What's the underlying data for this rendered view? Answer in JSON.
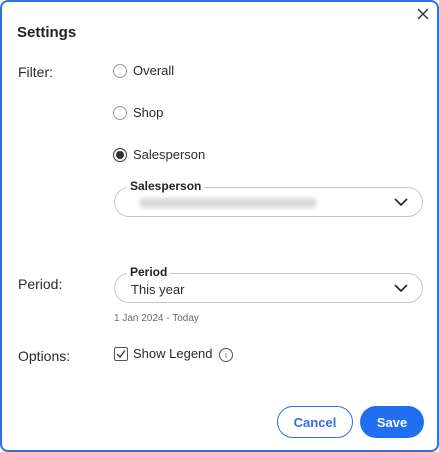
{
  "dialog": {
    "title": "Settings",
    "close_icon": "close-icon"
  },
  "filter": {
    "label": "Filter:",
    "options": [
      {
        "label": "Overall",
        "checked": false
      },
      {
        "label": "Shop",
        "checked": false
      },
      {
        "label": "Salesperson",
        "checked": true
      }
    ],
    "salesperson_select": {
      "legend": "Salesperson",
      "value": ""
    }
  },
  "period": {
    "label": "Period:",
    "select": {
      "legend": "Period",
      "value": "This year"
    },
    "range_hint": "1 Jan 2024 - Today"
  },
  "options": {
    "label": "Options:",
    "show_legend": {
      "label": "Show Legend",
      "checked": true
    },
    "info_icon": "info-icon"
  },
  "actions": {
    "cancel_label": "Cancel",
    "save_label": "Save"
  },
  "colors": {
    "accent": "#1f6ff0",
    "border": "#2f6fde"
  }
}
